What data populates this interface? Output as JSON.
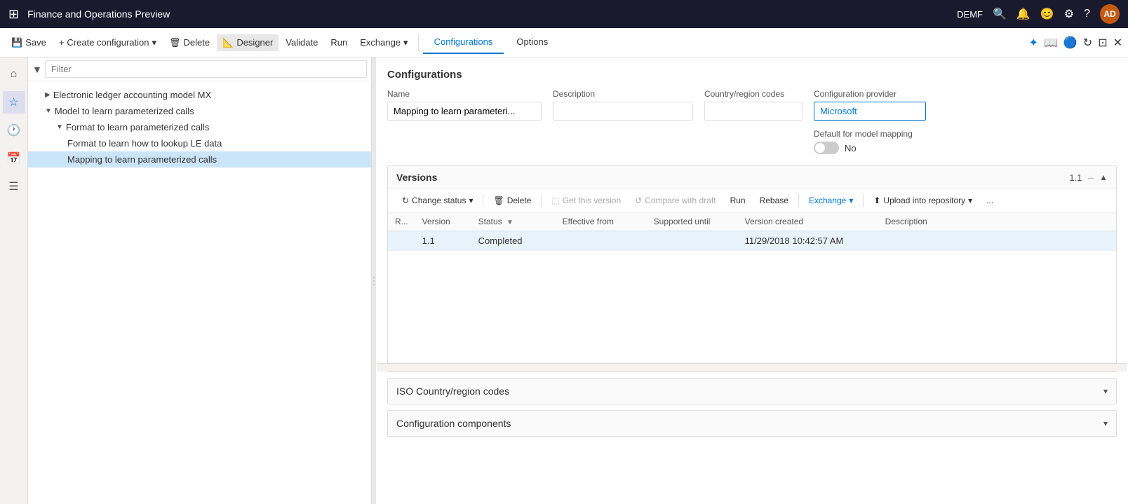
{
  "app": {
    "title": "Finance and Operations Preview",
    "user": "DEMF",
    "avatar": "AD"
  },
  "toolbar": {
    "save_label": "Save",
    "create_config_label": "Create configuration",
    "delete_label": "Delete",
    "designer_label": "Designer",
    "validate_label": "Validate",
    "run_label": "Run",
    "exchange_label": "Exchange",
    "configurations_label": "Configurations",
    "options_label": "Options"
  },
  "tree": {
    "filter_placeholder": "Filter",
    "items": [
      {
        "label": "Electronic ledger accounting model MX",
        "level": 1,
        "collapsed": true,
        "selected": false
      },
      {
        "label": "Model to learn parameterized calls",
        "level": 1,
        "collapsed": false,
        "selected": false
      },
      {
        "label": "Format to learn parameterized calls",
        "level": 2,
        "collapsed": false,
        "selected": false
      },
      {
        "label": "Format to learn how to lookup LE data",
        "level": 3,
        "selected": false
      },
      {
        "label": "Mapping to learn parameterized calls",
        "level": 3,
        "selected": true
      }
    ]
  },
  "content": {
    "section_title": "Configurations",
    "fields": {
      "name_label": "Name",
      "name_value": "Mapping to learn parameteri...",
      "description_label": "Description",
      "description_value": "",
      "country_label": "Country/region codes",
      "country_value": "",
      "provider_label": "Configuration provider",
      "provider_value": "Microsoft",
      "default_mapping_label": "Default for model mapping",
      "default_mapping_toggle": "No"
    },
    "versions": {
      "title": "Versions",
      "version_num": "1.1",
      "toolbar": {
        "change_status": "Change status",
        "delete": "Delete",
        "get_version": "Get this version",
        "compare_draft": "Compare with draft",
        "run": "Run",
        "rebase": "Rebase",
        "exchange": "Exchange",
        "upload_repo": "Upload into repository",
        "more": "..."
      },
      "table": {
        "headers": [
          "R...",
          "Version",
          "Status",
          "Effective from",
          "Supported until",
          "Version created",
          "Description"
        ],
        "rows": [
          {
            "check": "",
            "version": "1.1",
            "status": "Completed",
            "effective_from": "",
            "supported_until": "",
            "version_created": "11/29/2018 10:42:57 AM",
            "description": ""
          }
        ]
      }
    },
    "iso_section": {
      "title": "ISO Country/region codes"
    },
    "config_components": {
      "title": "Configuration components"
    }
  }
}
